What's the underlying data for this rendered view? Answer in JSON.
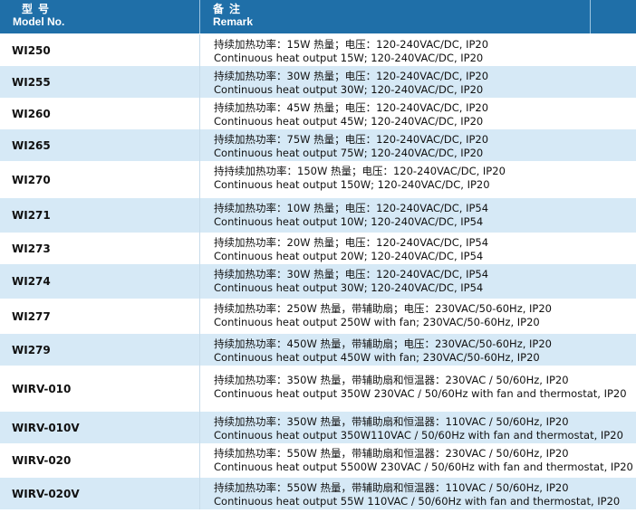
{
  "header": {
    "model_cn": "型号",
    "model_en": "Model No.",
    "remark_cn": "备注",
    "remark_en": "Remark"
  },
  "rows": [
    {
      "model": "WI250",
      "cn": "持续加热功率：15W 热量；电压：120-240VAC/DC, IP20",
      "en": "Continuous heat output 15W; 120-240VAC/DC, IP20"
    },
    {
      "model": "WI255",
      "cn": "持续加热功率：30W 热量；电压：120-240VAC/DC, IP20",
      "en": "Continuous heat output 30W; 120-240VAC/DC, IP20"
    },
    {
      "model": "WI260",
      "cn": "持续加热功率：45W 热量；电压：120-240VAC/DC, IP20",
      "en": "Continuous heat output 45W; 120-240VAC/DC, IP20"
    },
    {
      "model": "WI265",
      "cn": "持续加热功率：75W 热量；电压：120-240VAC/DC, IP20",
      "en": "Continuous heat output 75W; 120-240VAC/DC, IP20"
    },
    {
      "model": "WI270",
      "cn": "持持续加热功率：150W 热量；电压：120-240VAC/DC, IP20",
      "en": "Continuous heat output 150W; 120-240VAC/DC, IP20"
    },
    {
      "model": "WI271",
      "cn": "持续加热功率：10W 热量；电压：120-240VAC/DC, IP54",
      "en": "Continuous heat output 10W; 120-240VAC/DC, IP54"
    },
    {
      "model": "WI273",
      "cn": "持续加热功率：20W 热量；电压：120-240VAC/DC, IP54",
      "en": "Continuous heat output 20W; 120-240VAC/DC, IP54"
    },
    {
      "model": "WI274",
      "cn": "持续加热功率：30W 热量；电压：120-240VAC/DC, IP54",
      "en": "Continuous heat output 30W; 120-240VAC/DC, IP54"
    },
    {
      "model": "WI277",
      "cn": "持续加热功率：250W 热量，带辅助扇；电压：230VAC/50-60Hz, IP20",
      "en": "Continuous heat output 250W with fan; 230VAC/50-60Hz, IP20"
    },
    {
      "model": "WI279",
      "cn": "持续加热功率：450W 热量，带辅助扇；电压：230VAC/50-60Hz, IP20",
      "en": "Continuous heat output 450W with fan; 230VAC/50-60Hz, IP20"
    },
    {
      "model": "WIRV-010",
      "cn": "持续加热功率：350W 热量，带辅助扇和恒温器：230VAC / 50/60Hz, IP20",
      "en": "Continuous heat output 350W 230VAC / 50/60Hz with fan and thermostat, IP20"
    },
    {
      "model": "WIRV-010V",
      "cn": "持续加热功率：350W 热量，带辅助扇和恒温器：110VAC / 50/60Hz, IP20",
      "en": "Continuous heat output 350W110VAC / 50/60Hz with fan and thermostat, IP20"
    },
    {
      "model": "WIRV-020",
      "cn": "持续加热功率：550W 热量，带辅助扇和恒温器：230VAC / 50/60Hz, IP20",
      "en": "Continuous heat output 5500W 230VAC / 50/60Hz with fan and thermostat, IP20"
    },
    {
      "model": "WIRV-020V",
      "cn": "持续加热功率：550W 热量，带辅助扇和恒温器：110VAC / 50/60Hz, IP20",
      "en": "Continuous heat output 55W 110VAC / 50/60Hz with fan and thermostat, IP20"
    }
  ]
}
